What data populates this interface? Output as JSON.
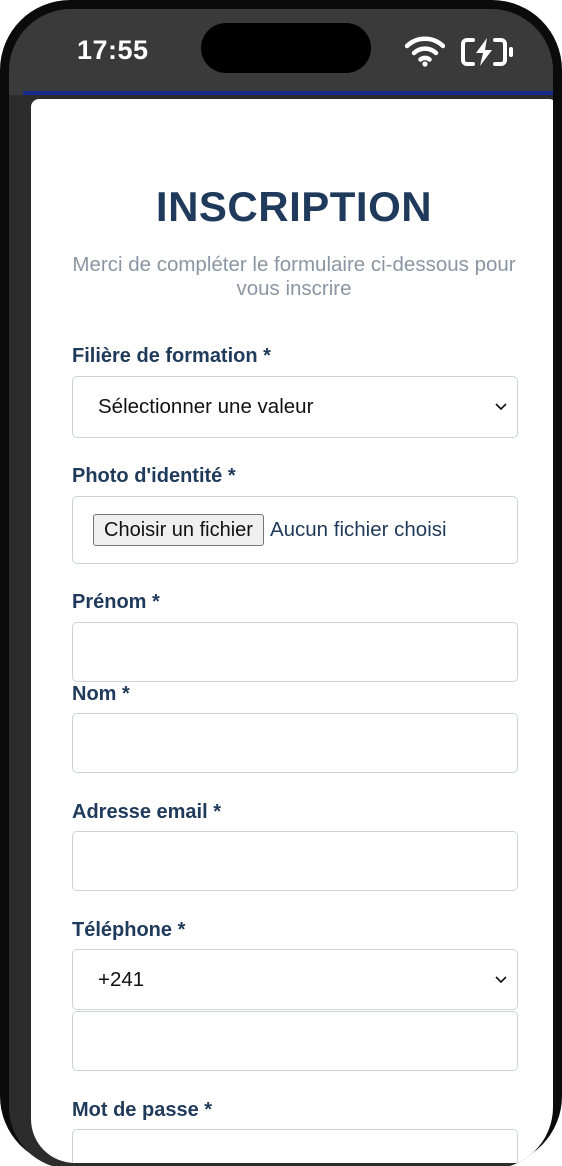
{
  "status_bar": {
    "time": "17:55"
  },
  "form": {
    "title": "INSCRIPTION",
    "subtitle": "Merci de compléter le formulaire ci-dessous pour vous inscrire",
    "filiere": {
      "label": "Filière de formation *",
      "selected": "Sélectionner une valeur"
    },
    "photo": {
      "label": "Photo d'identité *",
      "button": "Choisir un fichier",
      "status": "Aucun fichier choisi"
    },
    "prenom": {
      "label": "Prénom *",
      "value": ""
    },
    "nom": {
      "label": "Nom *",
      "value": ""
    },
    "email": {
      "label": "Adresse email *",
      "value": ""
    },
    "telephone": {
      "label": "Téléphone *",
      "country_code": "+241",
      "value": ""
    },
    "password": {
      "label": "Mot de passe *",
      "value": ""
    }
  },
  "colors": {
    "heading": "#1f3a5a",
    "subtitle": "#8a96a3",
    "field_border": "#cfd3d8",
    "status_bar": "#3a3a3a"
  },
  "icons": [
    "wifi-icon",
    "battery-charging-icon",
    "chevron-down-icon"
  ]
}
